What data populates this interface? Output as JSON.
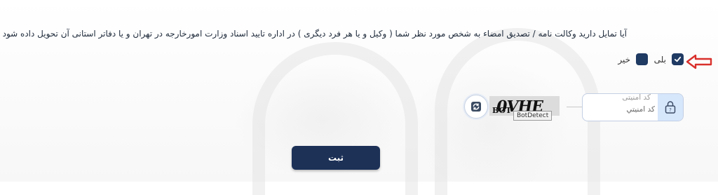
{
  "form": {
    "question": "آیا تمایل دارید وکالت نامه / تصدیق امضاء به شخص مورد نظر شما ( وکیل و یا هر فرد دیگری ) در اداره تایید اسناد وزارت امورخارجه در تهران و یا دفاتر استانی آن تحویل داده شود ؟",
    "options": [
      {
        "label": "بلی",
        "checked": true
      },
      {
        "label": "خیر",
        "checked": false
      }
    ]
  },
  "captcha": {
    "image_text": "0VHE",
    "image_small_text": "BOT",
    "tooltip": "BotDetect",
    "field_label": "کد امنیتی",
    "field_placeholder": "کد امنیتي",
    "refresh_icon": "refresh-icon",
    "lock_icon": "lock-icon"
  },
  "submit": {
    "label": "ثبت"
  },
  "colors": {
    "primary": "#1d3157",
    "checkbox": "#1f3a63",
    "arrow": "#d9302c",
    "lock_bg": "#d6e6fb"
  }
}
